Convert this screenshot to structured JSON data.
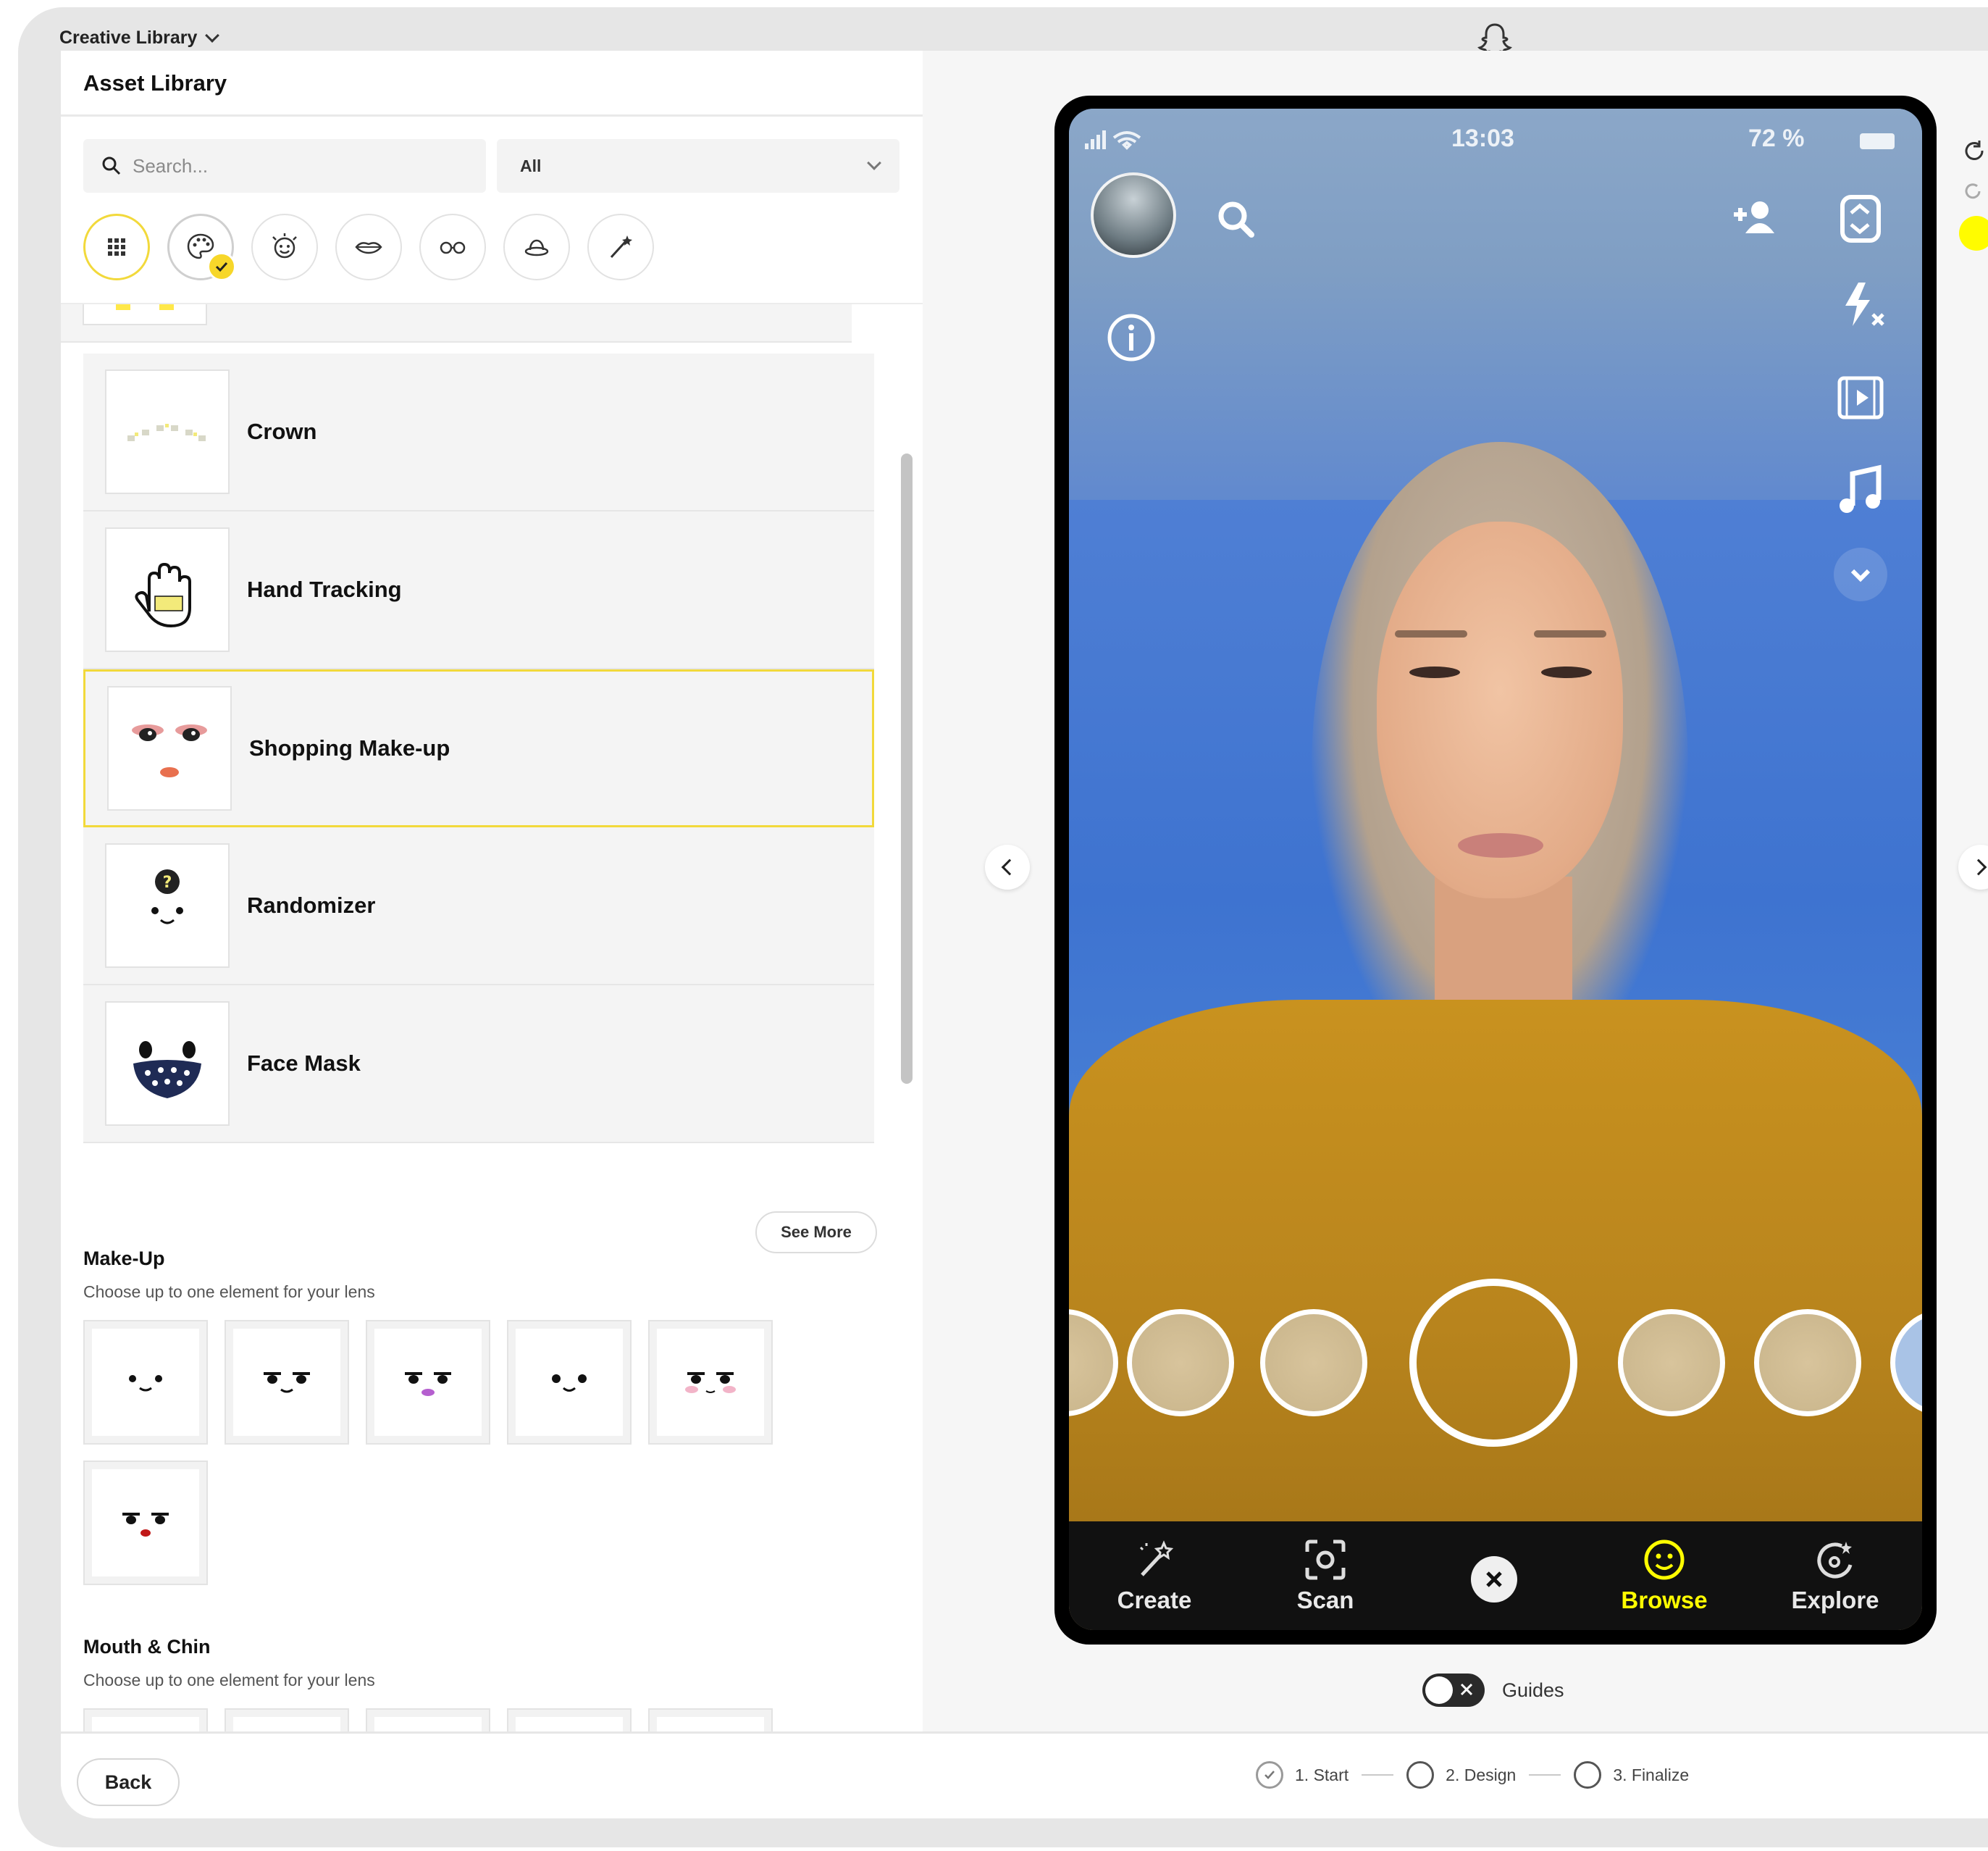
{
  "topbar": {
    "title": "Creative Library"
  },
  "asset_library": {
    "title": "Asset Library",
    "search_placeholder": "Search...",
    "filter_value": "All",
    "category_icons": [
      "grid-icon",
      "palette-icon",
      "face-icon",
      "lips-icon",
      "glasses-icon",
      "hat-icon",
      "magic-wand-icon"
    ],
    "items": [
      {
        "name": "Crown",
        "icon": "crown-thumbnail"
      },
      {
        "name": "Hand Tracking",
        "icon": "hand-thumbnail"
      },
      {
        "name": "Shopping Make-up",
        "icon": "makeup-face-thumbnail",
        "selected": true
      },
      {
        "name": "Randomizer",
        "icon": "question-face-thumbnail"
      },
      {
        "name": "Face Mask",
        "icon": "star-mask-thumbnail"
      }
    ],
    "see_more": "See More",
    "makeup": {
      "title": "Make-Up",
      "subtitle": "Choose up to one element for your lens"
    },
    "mouth": {
      "title": "Mouth & Chin",
      "subtitle": "Choose up to one element for your lens"
    }
  },
  "preview": {
    "status_time": "13:03",
    "status_battery": "72 %",
    "nav": [
      {
        "label": "Create",
        "icon": "create-icon"
      },
      {
        "label": "Scan",
        "icon": "scan-icon"
      },
      {
        "label": "Browse",
        "icon": "browse-icon",
        "active": true
      },
      {
        "label": "Explore",
        "icon": "explore-icon"
      }
    ],
    "guides_label": "Guides",
    "accent_color": "#fffc00"
  },
  "footer": {
    "back_label": "Back",
    "steps": [
      "1. Start",
      "2. Design",
      "3. Finalize"
    ]
  }
}
